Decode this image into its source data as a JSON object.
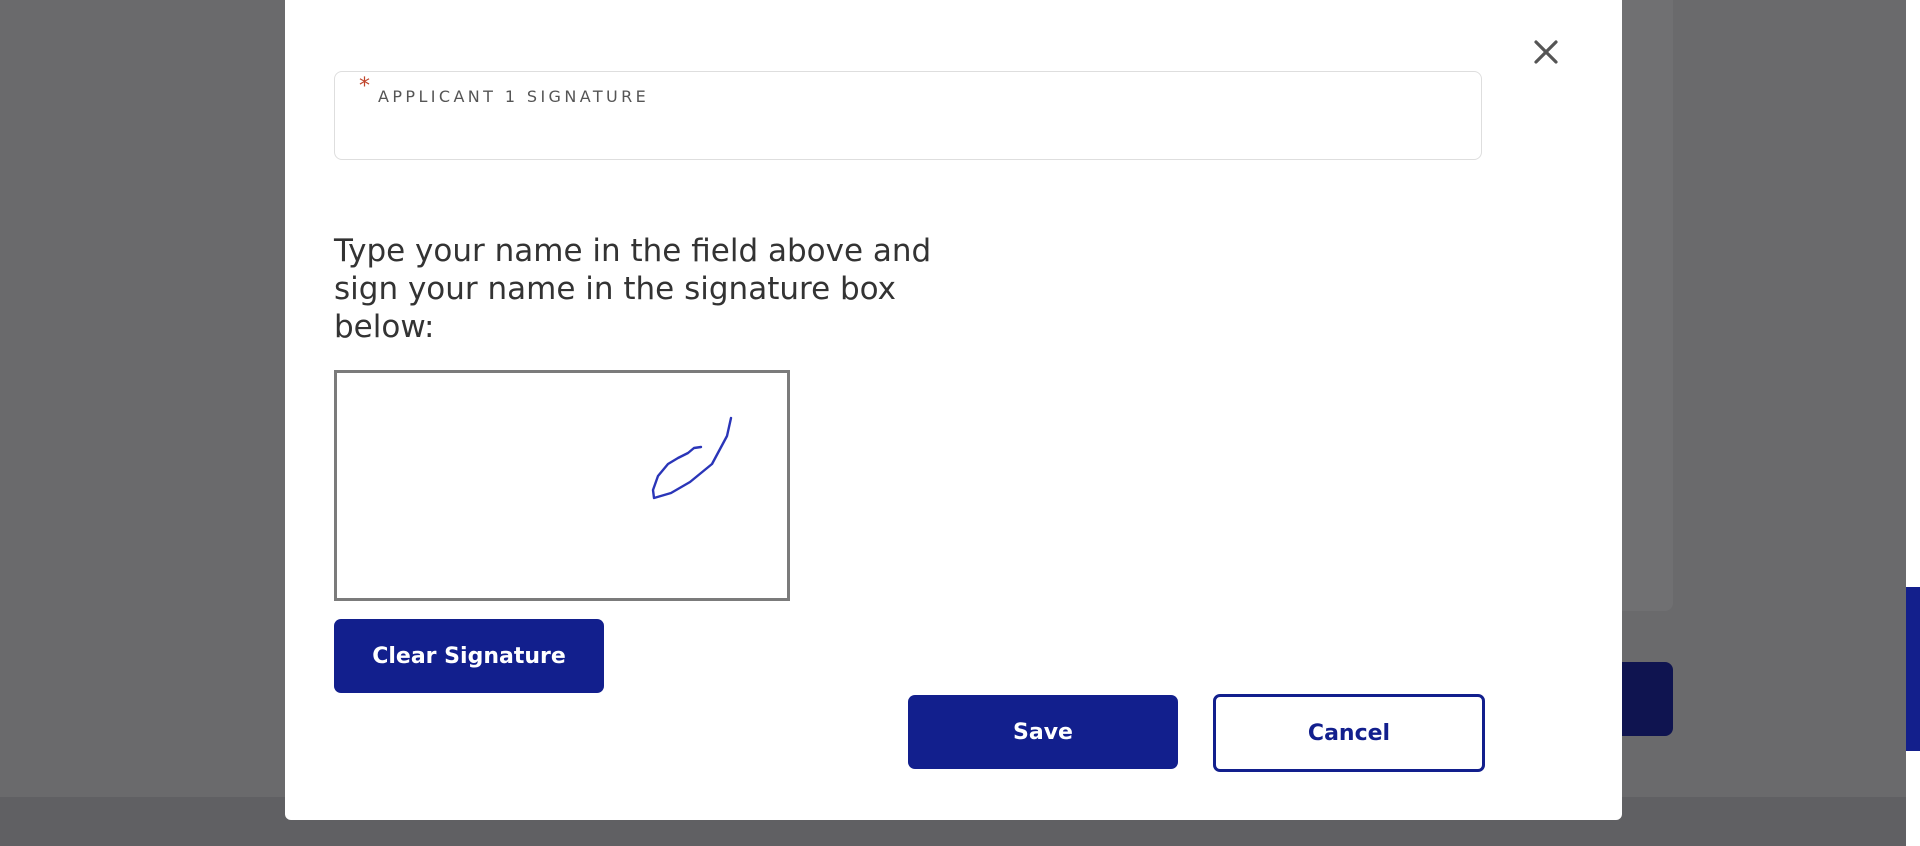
{
  "modal": {
    "signature_field": {
      "required_marker": "*",
      "label": "APPLICANT 1 SIGNATURE",
      "value": ""
    },
    "instructions": "Type your name in the field above and sign your name in the signature box below:",
    "signature_pad": {
      "stroke_color": "#2a35b8"
    },
    "buttons": {
      "clear": "Clear Signature",
      "save": "Save",
      "cancel": "Cancel"
    },
    "close_icon": "close-icon"
  },
  "colors": {
    "primary": "#121f8d",
    "backdrop": "#6a6a6c",
    "required": "#c0452c"
  }
}
